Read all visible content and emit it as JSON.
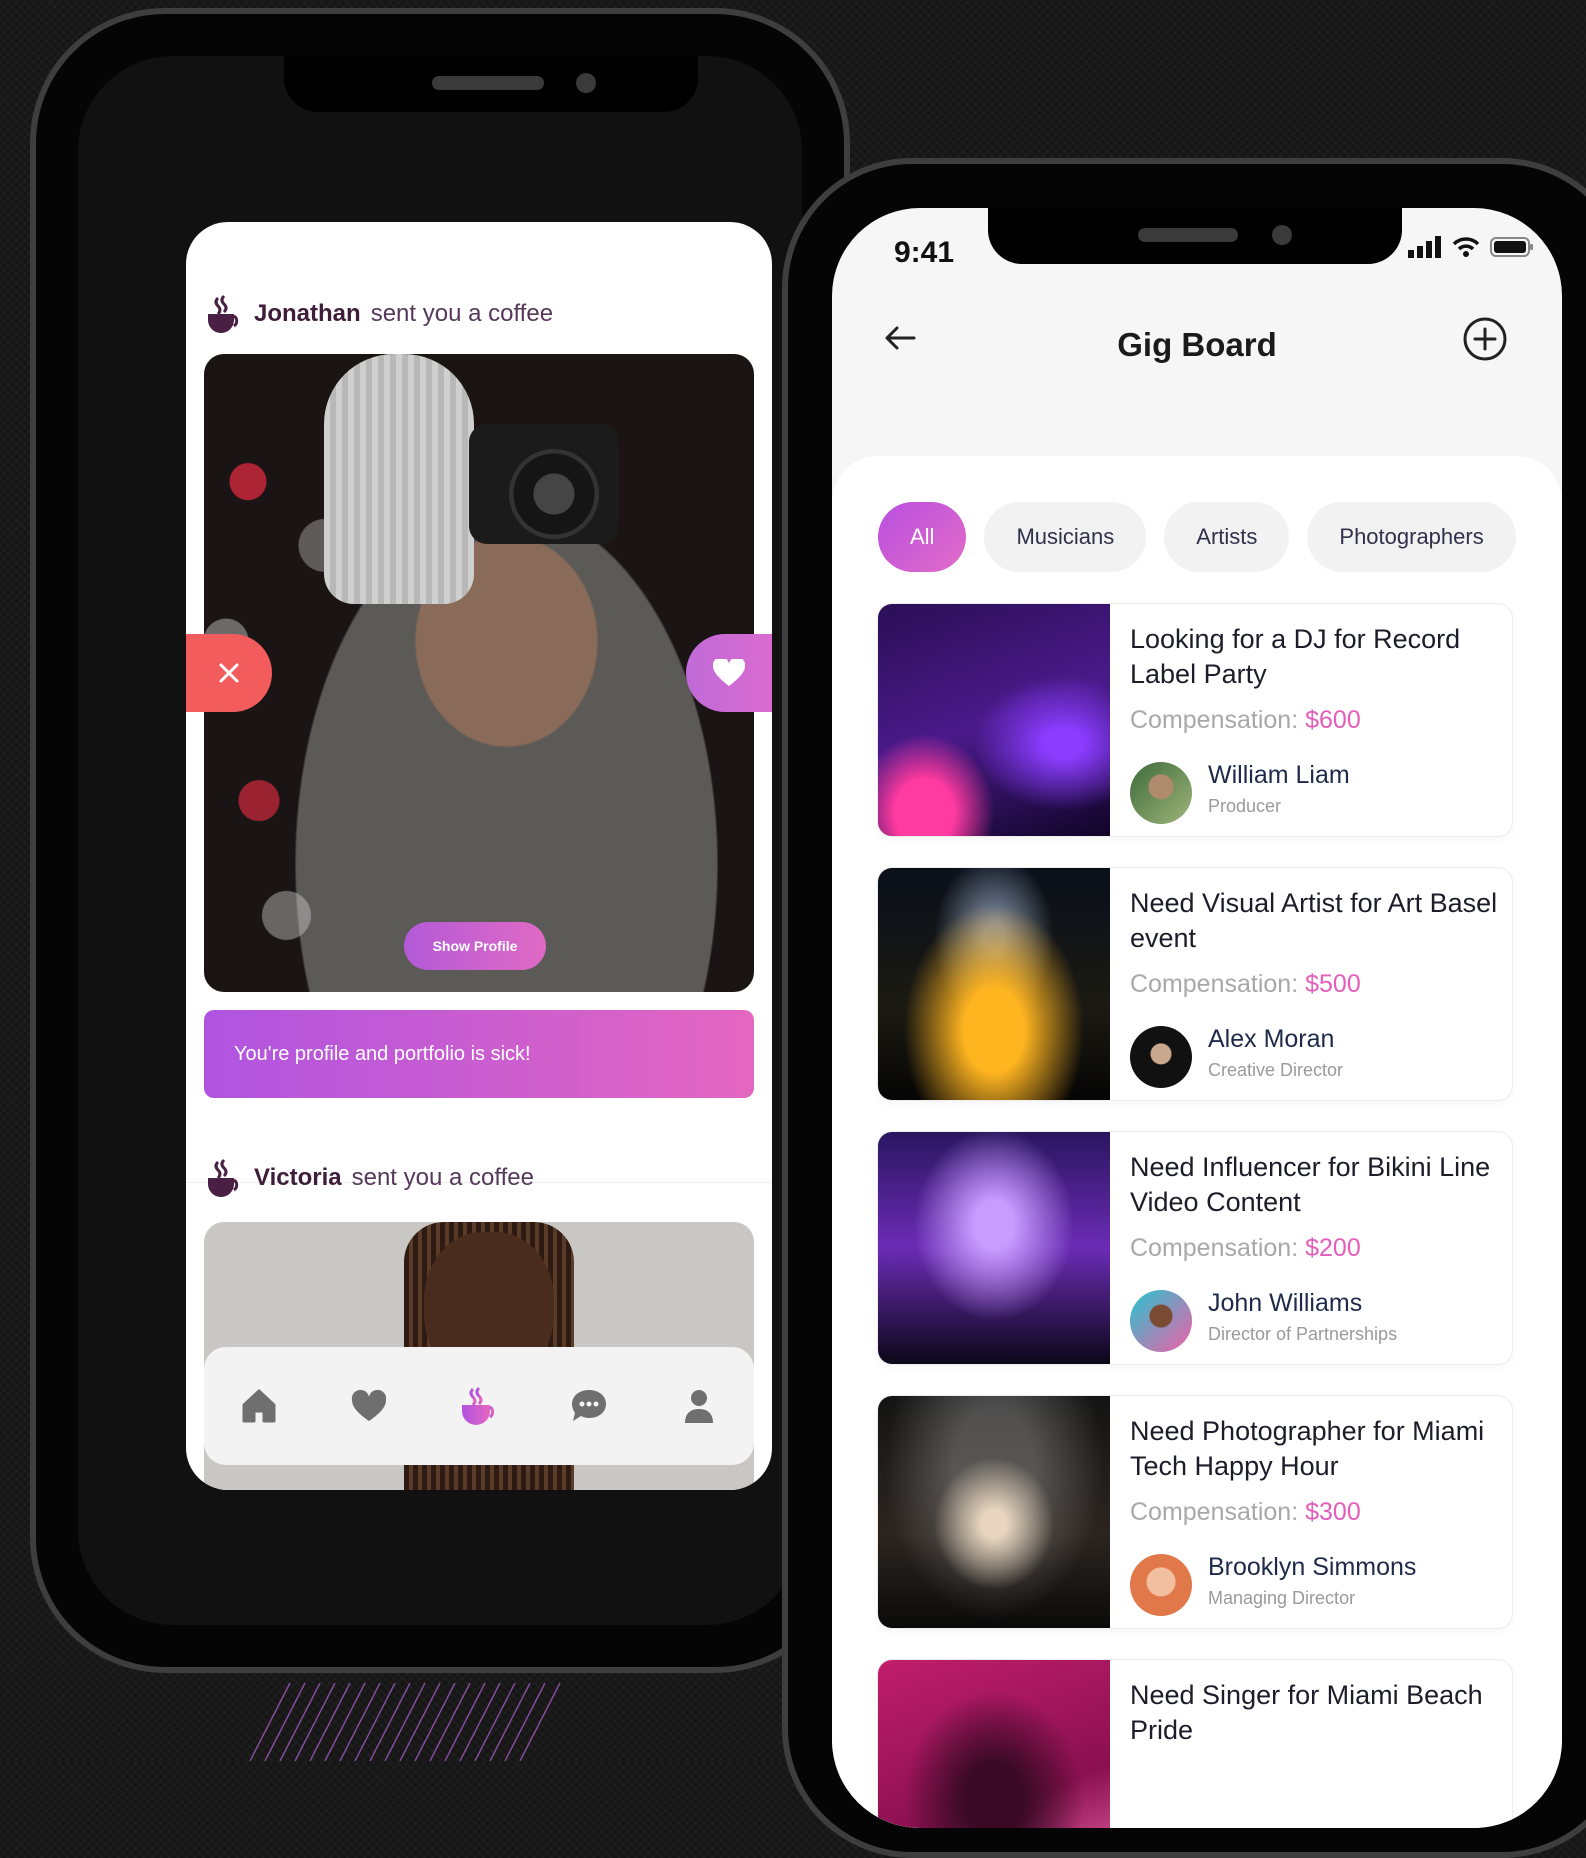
{
  "coffee_app": {
    "notifications": [
      {
        "name": "Jonathan",
        "text": "sent you a coffee"
      },
      {
        "name": "Victoria",
        "text": "sent you a coffee"
      }
    ],
    "show_profile_label": "Show Profile",
    "message": "You're profile and portfolio is sick!",
    "nav_icons": [
      "home-icon",
      "heart-icon",
      "coffee-icon",
      "chat-icon",
      "profile-icon"
    ],
    "accent_gradient": [
      "#b054e0",
      "#e466c0"
    ],
    "reject_color": "#f25c5c"
  },
  "gig_board": {
    "status_time": "9:41",
    "title": "Gig Board",
    "filters": [
      "All",
      "Musicians",
      "Artists",
      "Photographers"
    ],
    "active_filter": "All",
    "compensation_label": "Compensation:",
    "gigs": [
      {
        "title": "Looking for a DJ for Record Label Party",
        "amount": "$600",
        "poster": "William Liam",
        "role": "Producer"
      },
      {
        "title": "Need Visual Artist for Art Basel event",
        "amount": "$500",
        "poster": "Alex Moran",
        "role": "Creative Director"
      },
      {
        "title": "Need Influencer for Bikini Line Video Content",
        "amount": "$200",
        "poster": "John Williams",
        "role": "Director of Partnerships"
      },
      {
        "title": "Need Photographer for Miami Tech Happy Hour",
        "amount": "$300",
        "poster": "Brooklyn Simmons",
        "role": "Managing Director"
      },
      {
        "title": "Need Singer for Miami Beach Pride",
        "amount": "",
        "poster": "",
        "role": ""
      }
    ],
    "accent_color": "#e45dbd"
  }
}
